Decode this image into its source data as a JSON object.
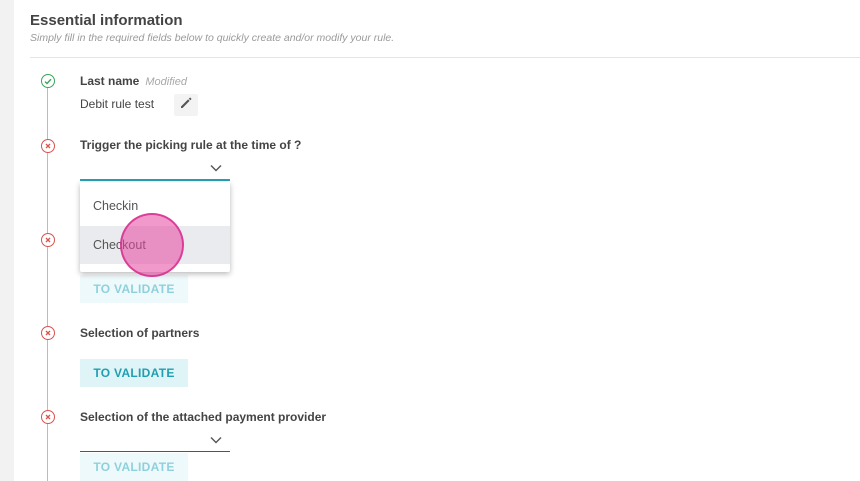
{
  "header": {
    "title": "Essential information",
    "subtitle": "Simply fill in the required fields below to quickly create and/or modify your rule."
  },
  "steps": [
    {
      "label": "Last name",
      "badge": "Modified",
      "value": "Debit rule test",
      "status": "valid"
    },
    {
      "label": "Trigger the picking rule at the time of ?",
      "status": "invalid"
    },
    {
      "status": "invalid",
      "button": "TO VALIDATE"
    },
    {
      "label": "Selection of partners",
      "status": "invalid",
      "button": "TO VALIDATE"
    },
    {
      "label": "Selection of the attached payment provider",
      "status": "invalid",
      "button": "TO VALIDATE"
    }
  ],
  "dropdown": {
    "options": [
      "Checkin",
      "Checkout"
    ],
    "highlighted": "Checkout"
  },
  "colors": {
    "valid": "#3aa657",
    "invalid": "#d9534f",
    "accent": "#1f9fb1",
    "cursor": "#e846a0"
  },
  "icons": {
    "edit": "pencil-icon",
    "valid": "check-circle-icon",
    "invalid": "x-circle-icon",
    "select": "chevron-down-icon"
  }
}
